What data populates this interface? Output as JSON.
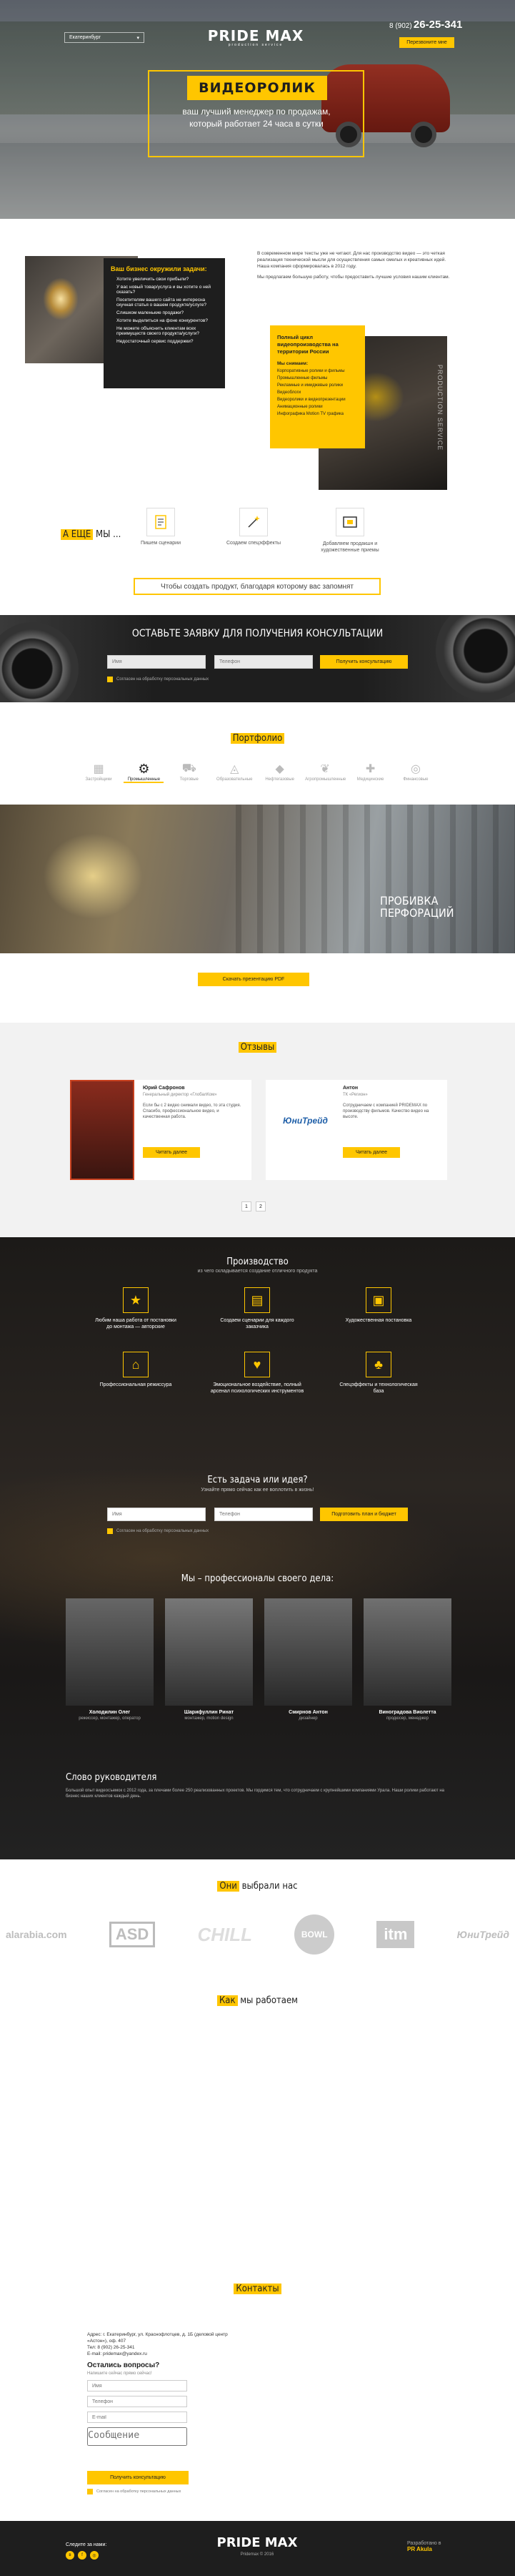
{
  "header": {
    "city": "Екатеринбург",
    "logo": "PRIDE MAX",
    "logo_sub": "production service",
    "phone_prefix": "8 (902)",
    "phone_main": "26-25-341",
    "callback": "Перезвоните мне"
  },
  "hero": {
    "title": "ВИДЕОРОЛИК",
    "subtitle_line1": "ваш лучший менеджер по продажам,",
    "subtitle_line2": "который работает 24 часа в сутки"
  },
  "tasks": {
    "title": "Ваш бизнес окружили задачи:",
    "items": [
      "Хотите увеличить свои прибыли?",
      "У вас новый товар/услуга и вы хотите о ней сказать?",
      "Посетителям вашего сайта не интересна скучная статья о вашем продукте/услуге?",
      "Слишком маленькие продажи?",
      "Хотите выделиться на фоне конкурентов?",
      "Не можете объяснить клиентам всех преимуществ своего продукта/услуги?",
      "Недостаточный сервис поддержки?"
    ],
    "intro_p1": "В современном мире тексты уже не читают. Для нас производство видео — это четкая реализация технической мысли для осуществления самых смелых и креативных идей. Наша компания сформировалась в 2012 году.",
    "intro_p2": "Мы предлагаем большую работу, чтобы предоставить лучшие условия нашим клиентам.",
    "card_title": "Полный цикл видеопроизводства на территории России",
    "card_subtitle": "Мы снимаем:",
    "card_items": [
      "Корпоративные ролики и фильмы",
      "Промышленные фильмы",
      "Рекламные и имиджевые ролики",
      "Видеоблоги",
      "Видеоролики и видеопрезентации",
      "Анимационные ролики",
      "Инфографика Motion TV графика"
    ],
    "card_vertical": "PRODUCTION SERVICE"
  },
  "also": {
    "title_hl": "А ЕЩЕ",
    "title_rest": "МЫ ...",
    "items": [
      "Пишем сценарии",
      "Создаем спецэффекты",
      "Добавляем продакшн и художественные приемы"
    ],
    "banner": "Чтобы создать продукт, благодаря которому вас запомнят"
  },
  "consult": {
    "title": "ОСТАВЬТЕ ЗАЯВКУ ДЛЯ ПОЛУЧЕНИЯ КОНСУЛЬТАЦИИ",
    "name_ph": "Имя",
    "phone_ph": "Телефон",
    "button": "Получить консультацию",
    "agree": "Согласен на обработку персональных данных"
  },
  "portfolio": {
    "title": "Портфолио",
    "tabs": [
      "Застройщики",
      "Промышленные",
      "Торговые",
      "Образовательные",
      "Нефтегазовые",
      "Агропромышленные",
      "Медицинские",
      "Финансовые"
    ],
    "caption_line1": "ПРОБИВКА",
    "caption_line2": "ПЕРФОРАЦИЙ",
    "button": "Скачать презентацию PDF"
  },
  "reviews": {
    "title": "Отзывы",
    "r1_name": "Юрий Сафронов",
    "r1_role": "Генеральный директор «ГлобалКом»",
    "r1_text": "Если бы с 2 видео снимали видео, то эта студия. Спасибо, профессиональное видео, и качественная работа.",
    "r1_btn": "Читать далее",
    "r2_logo": "ЮниТрейд",
    "r2_name": "Антон",
    "r2_role": "ТК «Регион»",
    "r2_text": "Сотрудничаем с компанией PRIDEMAX по производству фильмов. Качество видео на высоте.",
    "r2_btn": "Читать далее",
    "pages": [
      "1",
      "2"
    ]
  },
  "production": {
    "title": "Производство",
    "subtitle": "из чего складывается создание отличного продукта",
    "items": [
      "Любим наша работа от постановки до монтажа — авторские",
      "Создаем сценарии для каждого заказчика",
      "Художественная постановка",
      "Профессиональная режиссура",
      "Эмоциональное воздействие, полный арсенал психологических инструментов",
      "Спецэффекты и технологическая база"
    ]
  },
  "idea": {
    "title": "Есть задача или идея?",
    "subtitle": "Узнайте прямо сейчас как ее воплотить в жизнь!",
    "name_ph": "Имя",
    "phone_ph": "Телефон",
    "button": "Подготовить план и бюджет",
    "agree": "Согласен на обработку персональных данных"
  },
  "team": {
    "title": "Мы – профессионалы своего дела:",
    "members": [
      {
        "name": "Холодилин Олег",
        "role": "режиссер, монтажер, оператор"
      },
      {
        "name": "Шарифуллин Ринат",
        "role": "монтажер, motion design"
      },
      {
        "name": "Смирнов Антон",
        "role": "дизайнер"
      },
      {
        "name": "Виноградова Виолетта",
        "role": "продюсер, менеджер"
      }
    ],
    "word_title": "Слово руководителя",
    "word_text": "Большой опыт видеосъемок с 2012 года, за плечами более 250 реализованных проектов. Мы гордимся тем, что сотрудничаем с крупнейшими компаниями Урала. Наши ролики работают на бизнес наших клиентов каждый день."
  },
  "clients": {
    "title_hl": "Они",
    "title_rest": "выбрали нас",
    "logos": [
      "alarabia.com",
      "ASD",
      "CHILL",
      "BOWL",
      "itm",
      "ЮниТрейд"
    ]
  },
  "how": {
    "title_hl": "Как",
    "title_rest": "мы работаем"
  },
  "contacts": {
    "title": "Контакты",
    "address": "Адрес: г. Екатеринбург, ул. Краснофлотцев, д. 1Б (деловой центр «Астон»), оф. 407",
    "phone": "Тел: 8 (902) 26-25-341",
    "email": "E-mail: pridemax@yandex.ru",
    "q_title": "Остались вопросы?",
    "q_sub": "Напишите сейчас прямо сейчас!",
    "name_ph": "Имя",
    "phone_ph": "Телефон",
    "email_ph": "E-mail",
    "msg_ph": "Сообщение",
    "button": "Получить консультацию",
    "agree": "Согласен на обработку персональных данных"
  },
  "footer": {
    "social": "Следите за нами:",
    "logo": "PRIDE MAX",
    "copy": "Pridemax © 2016",
    "dev_label": "Разработано в",
    "dev": "PR Akula"
  },
  "colors": {
    "accent": "#ffc600",
    "dark": "#1e1e1e"
  }
}
